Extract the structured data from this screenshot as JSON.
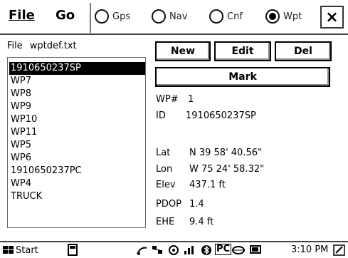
{
  "menu": {
    "file": "File",
    "go": "Go"
  },
  "tabs": [
    {
      "label": "Gps",
      "selected": false
    },
    {
      "label": "Nav",
      "selected": false
    },
    {
      "label": "Cnf",
      "selected": false
    },
    {
      "label": "Wpt",
      "selected": true
    }
  ],
  "close_label": "×",
  "file": {
    "label": "File",
    "name": "wptdef.txt"
  },
  "waypoints": [
    "1910650237SP",
    "WP7",
    "WP8",
    "WP9",
    "WP10",
    "WP11",
    "WP5",
    "WP6",
    "1910650237PC",
    "WP4",
    "TRUCK"
  ],
  "selected_waypoint_index": 0,
  "buttons": {
    "new": "New",
    "edit": "Edit",
    "del": "Del",
    "mark": "Mark"
  },
  "details": {
    "wp_num": {
      "label": "WP#",
      "value": "1"
    },
    "id": {
      "label": "ID",
      "value": "1910650237SP"
    },
    "lat": {
      "label": "Lat",
      "value": "N 39 58' 40.56\""
    },
    "lon": {
      "label": "Lon",
      "value": "W 75 24' 58.32\""
    },
    "elev": {
      "label": "Elev",
      "value": "437.1 ft"
    },
    "pdop": {
      "label": "PDOP",
      "value": "1.4"
    },
    "ehe": {
      "label": "EHE",
      "value": "9.4 ft"
    }
  },
  "taskbar": {
    "start": "Start",
    "time": "3:10 PM",
    "tray_pc": "PC"
  }
}
